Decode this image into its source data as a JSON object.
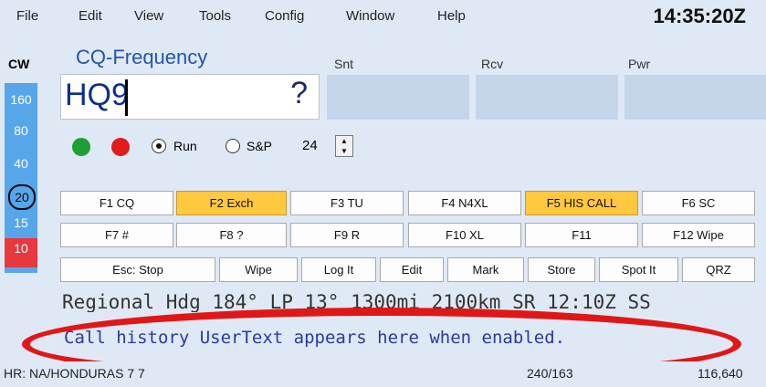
{
  "menu": [
    "File",
    "Edit",
    "View",
    "Tools",
    "Config",
    "Window",
    "Help"
  ],
  "clock": "14:35:20Z",
  "mode": "CW",
  "bands": [
    "160",
    "80",
    "40",
    "20",
    "15",
    "10"
  ],
  "current_band": "20",
  "cq_label": "CQ-Frequency",
  "call_entry": {
    "value": "HQ9",
    "status_glyph": "?"
  },
  "fields": {
    "snt": "Snt",
    "rcv": "Rcv",
    "pwr": "Pwr"
  },
  "mode_select": {
    "run": "Run",
    "sp": "S&P",
    "selected": "Run",
    "spin_value": "24"
  },
  "colors": {
    "green_dot": "#1e9f34",
    "red_dot": "#e21b1b",
    "highlight_key": "#ffc83e",
    "band_panel": "#57a6ea",
    "band_alert": "#e8383d"
  },
  "fkeys_row1": [
    "F1 CQ",
    "F2 Exch",
    "F3 TU",
    "F4 N4XL",
    "F5 HIS CALL",
    "F6 SC"
  ],
  "fkeys_row2": [
    "F7 #",
    "F8 ?",
    "F9 R",
    "F10 XL",
    "F11",
    "F12 Wipe"
  ],
  "actions": [
    "Esc: Stop",
    "Wipe",
    "Log It",
    "Edit",
    "Mark",
    "Store",
    "Spot It",
    "QRZ"
  ],
  "regional": "Regional Hdg 184° LP 13° 1300mi 2100km SR 12:10Z SS",
  "usertext": "Call history UserText appears here when enabled.",
  "status": {
    "left": "HR: NA/HONDURAS 7 7",
    "mid": "240/163",
    "right": "116,640"
  }
}
